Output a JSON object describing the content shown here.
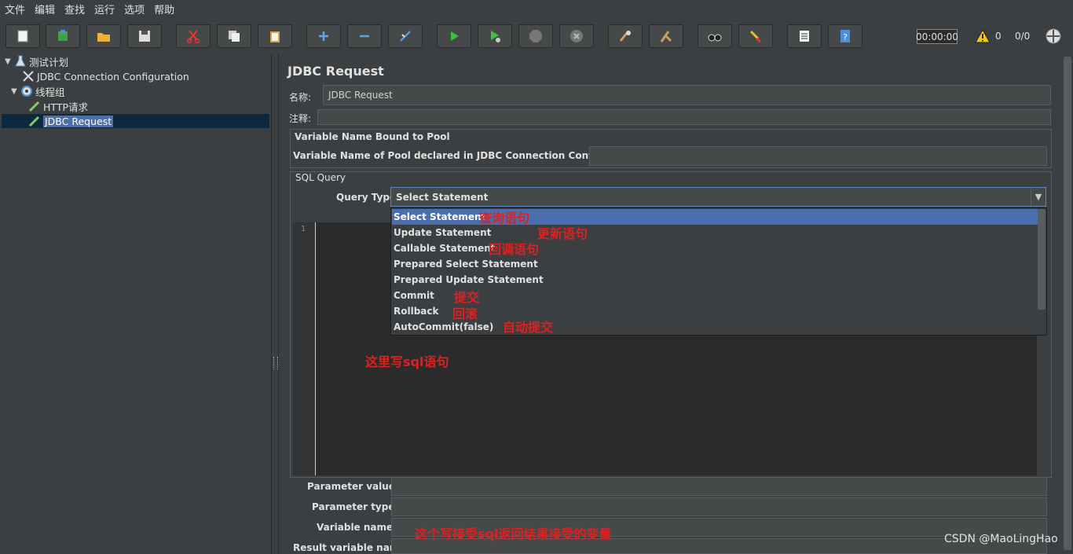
{
  "menu": [
    "文件",
    "编辑",
    "查找",
    "运行",
    "选项",
    "帮助"
  ],
  "toolbar": {
    "timer": "00:00:00",
    "warning_count": "0",
    "ratio": "0/0"
  },
  "tree": {
    "root": "测试计划",
    "jdbc_config": "JDBC Connection Configuration",
    "thread_group": "线程组",
    "http_request": "HTTP请求",
    "jdbc_request": "JDBC Request"
  },
  "panel": {
    "title": "JDBC Request",
    "name_label": "名称:",
    "name_value": "JDBC Request",
    "comment_label": "注释:",
    "pool_group_title": "Variable Name Bound to Pool",
    "pool_label": "Variable Name of Pool declared in JDBC Connection Configuration:",
    "sql_group_title": "SQL Query",
    "query_type_label": "Query Type:",
    "query_type_value": "Select Statement",
    "query_options": [
      "Select Statement",
      "Update Statement",
      "Callable Statement",
      "Prepared Select Statement",
      "Prepared Update Statement",
      "Commit",
      "Rollback",
      "AutoCommit(false)"
    ],
    "line_number": "1",
    "param_values_label": "Parameter values:",
    "param_types_label": "Parameter types:",
    "var_names_label": "Variable names:",
    "result_var_label": "Result variable name:"
  },
  "annotations": {
    "select": "查询语句",
    "update": "更新语句",
    "callable": "回调语句",
    "commit": "提交",
    "rollback": "回滚",
    "autocommit": "自动提交",
    "sql_here": "这里写sql语句",
    "vars_here": "这个写接受sql返回结果接受的变量"
  },
  "watermark": "CSDN @MaoLingHao"
}
